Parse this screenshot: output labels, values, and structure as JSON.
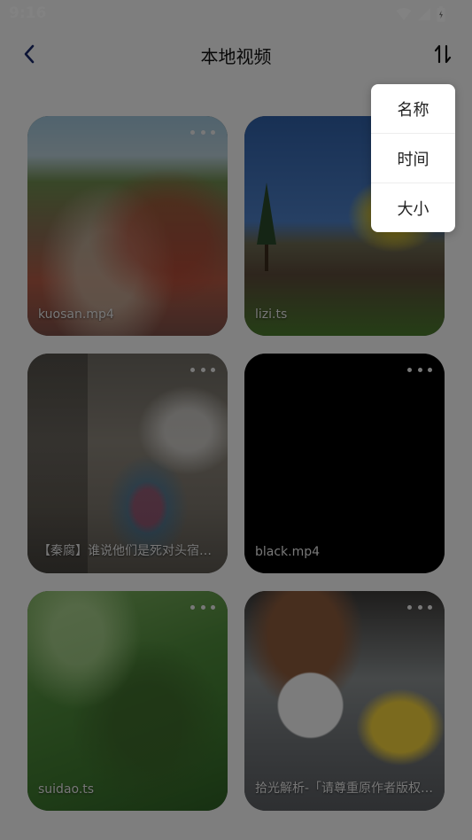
{
  "status_bar": {
    "time": "9:16"
  },
  "header": {
    "title": "本地视频",
    "back_icon": "back-chevron-icon",
    "sort_icon": "sort-arrows-icon"
  },
  "videos": [
    {
      "name": "kuosan.mp4"
    },
    {
      "name": "lizi.ts"
    },
    {
      "name": "【秦腐】谁说他们是死对头宿…"
    },
    {
      "name": "black.mp4"
    },
    {
      "name": "suidao.ts"
    },
    {
      "name": "拾光解析-「请尊重原作者版权…"
    }
  ],
  "sort_menu": {
    "items": [
      {
        "label": "名称"
      },
      {
        "label": "时间"
      },
      {
        "label": "大小"
      }
    ]
  },
  "colors": {
    "overlay": "#000000",
    "menu_bg": "#ffffff",
    "title_text": "#111111"
  }
}
